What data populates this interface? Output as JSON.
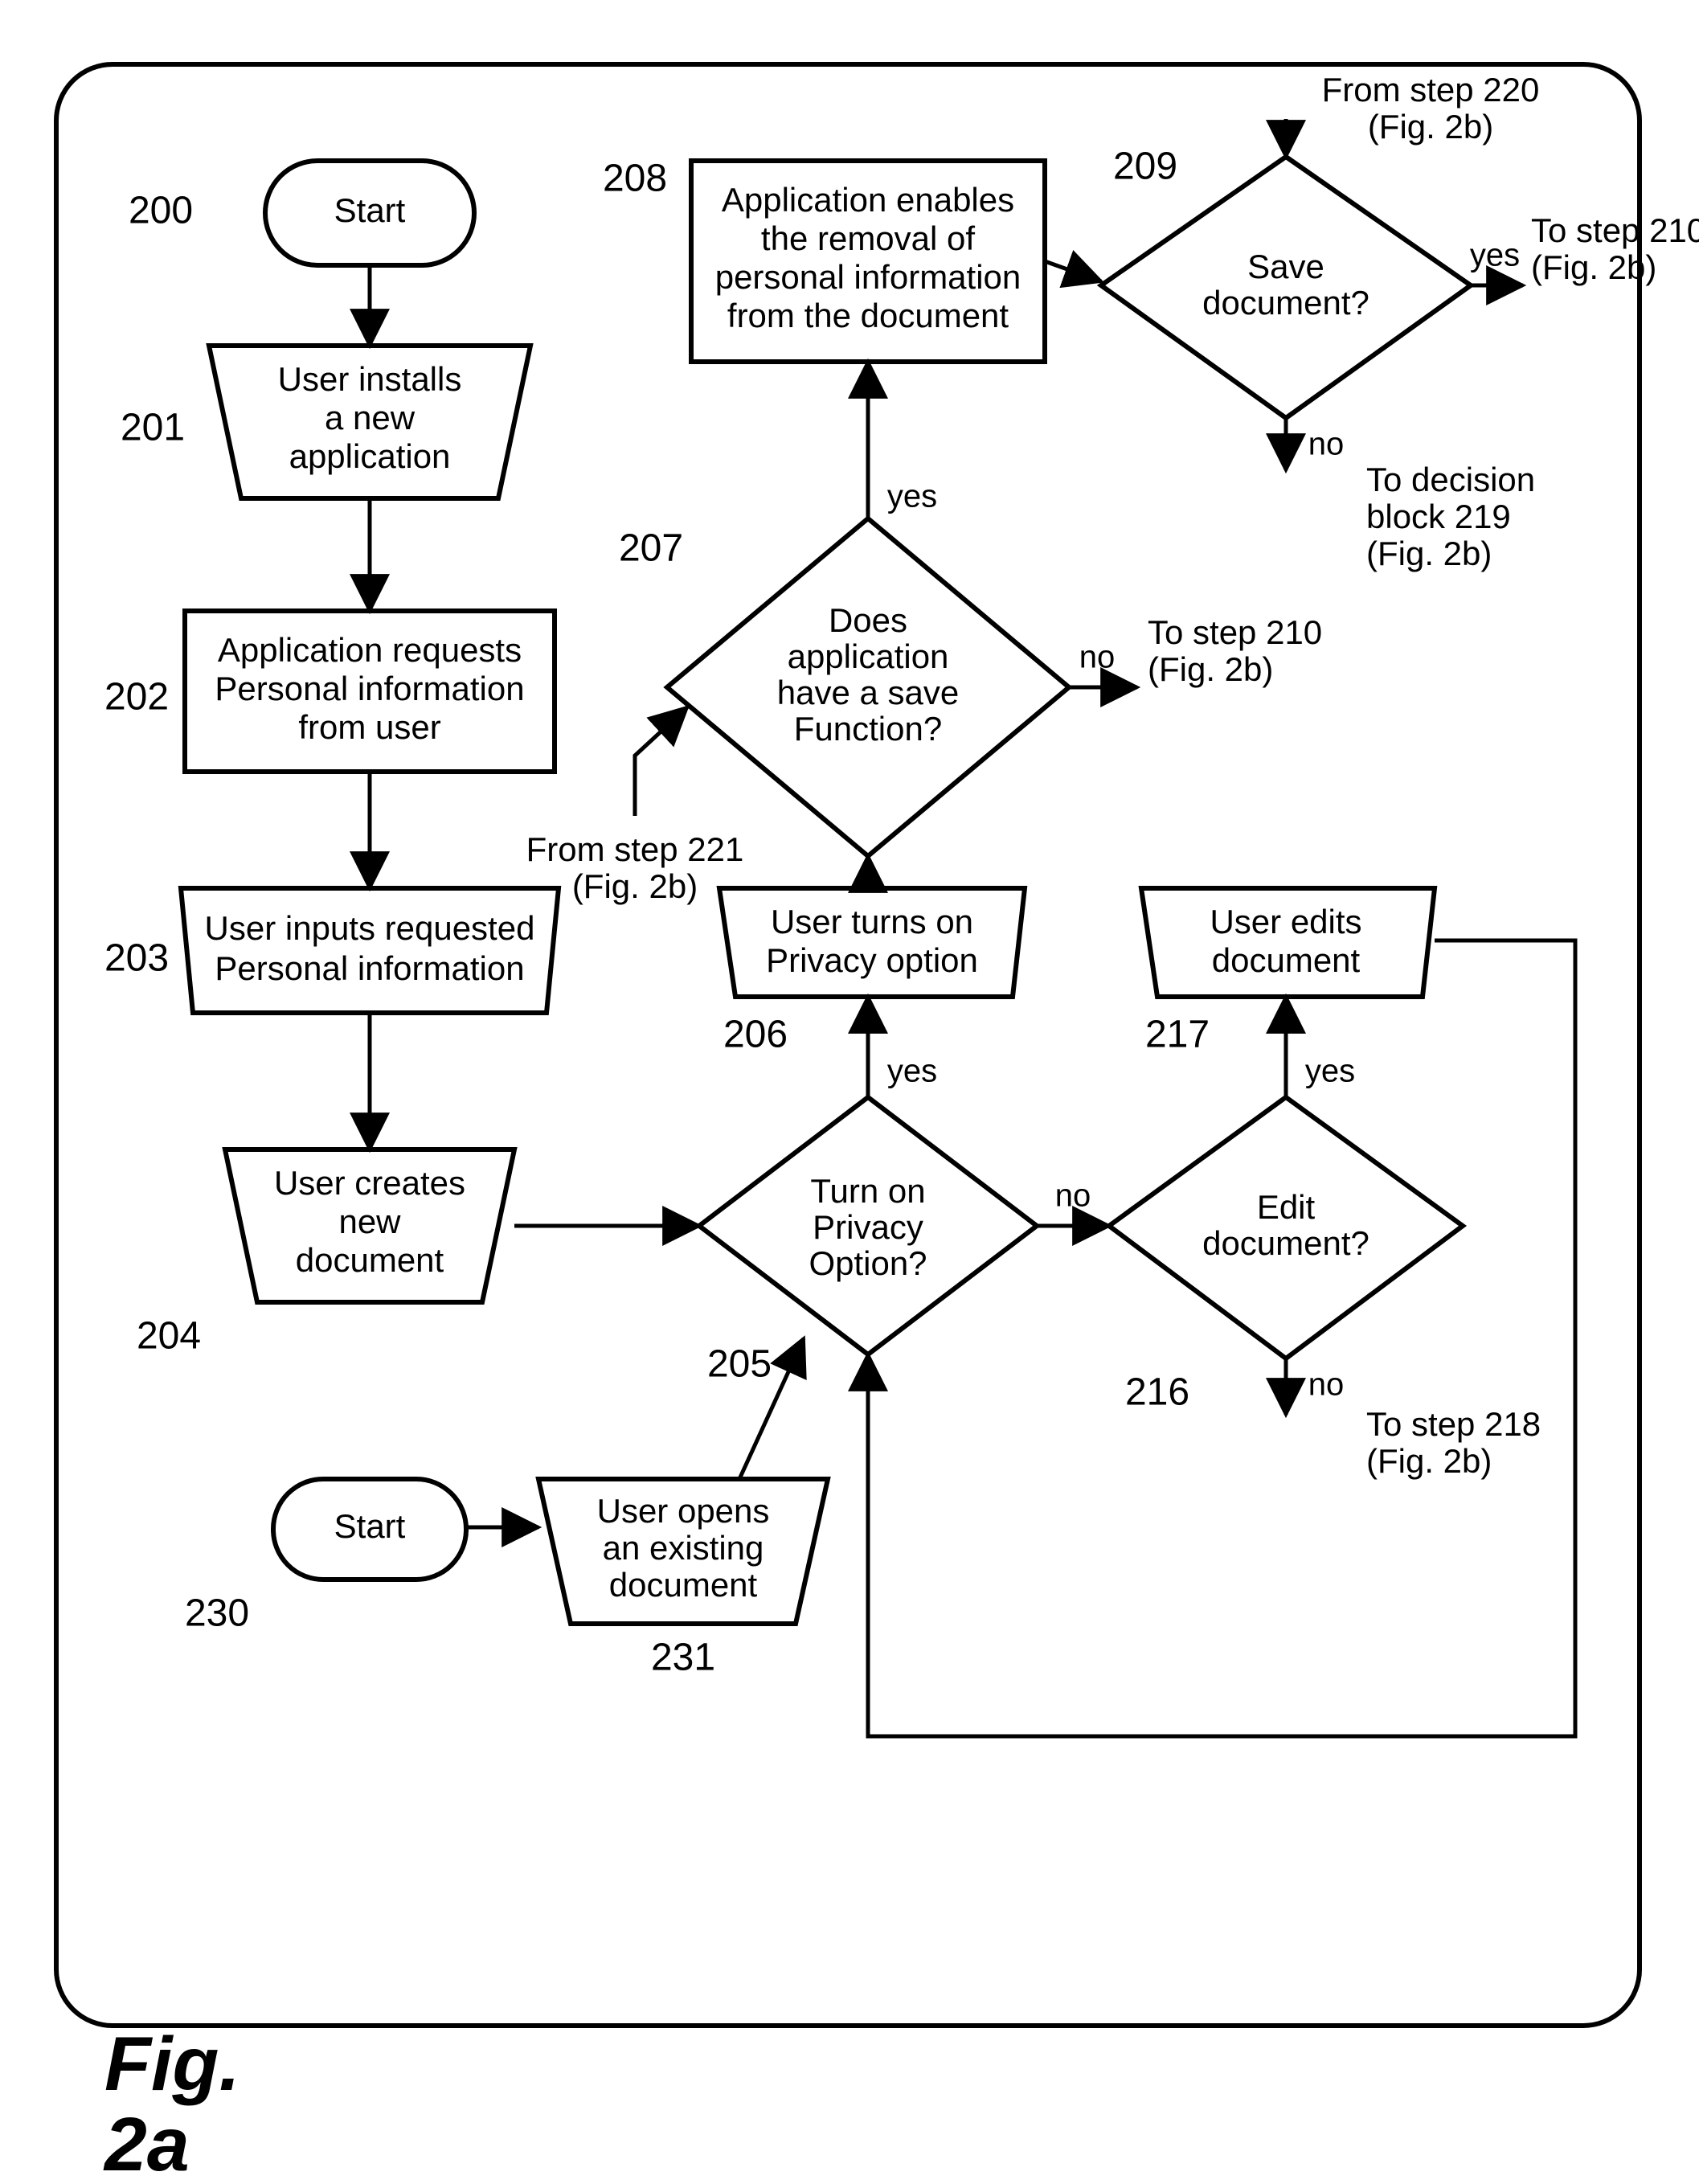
{
  "figure_label_top": "Fig.",
  "figure_label_bottom": "2a",
  "refs": {
    "r200": "200",
    "r201": "201",
    "r202": "202",
    "r203": "203",
    "r204": "204",
    "r205": "205",
    "r206": "206",
    "r207": "207",
    "r208": "208",
    "r209": "209",
    "r216": "216",
    "r217": "217",
    "r230": "230",
    "r231": "231"
  },
  "nodes": {
    "start1": "Start",
    "n201_l1": "User installs",
    "n201_l2": "a new",
    "n201_l3": "application",
    "n202_l1": "Application requests",
    "n202_l2": "Personal information",
    "n202_l3": "from user",
    "n203_l1": "User inputs requested",
    "n203_l2": "Personal information",
    "n204_l1": "User creates",
    "n204_l2": "new",
    "n204_l3": "document",
    "start2": "Start",
    "n231_l1": "User opens",
    "n231_l2": "an existing",
    "n231_l3": "document",
    "n205_l1": "Turn on",
    "n205_l2": "Privacy",
    "n205_l3": "Option?",
    "n206_l1": "User turns on",
    "n206_l2": "Privacy option",
    "n207_l1": "Does",
    "n207_l2": "application",
    "n207_l3": "have a save",
    "n207_l4": "Function?",
    "n208_l1": "Application enables",
    "n208_l2": "the removal of",
    "n208_l3": "personal information",
    "n208_l4": "from the document",
    "n209_l1": "Save",
    "n209_l2": "document?",
    "n216_l1": "Edit",
    "n216_l2": "document?",
    "n217_l1": "User edits",
    "n217_l2": "document"
  },
  "edges": {
    "yes": "yes",
    "no": "no"
  },
  "offpage": {
    "from221_l1": "From step 221",
    "from221_l2": "(Fig. 2b)",
    "from220_l1": "From step 220",
    "from220_l2": "(Fig. 2b)",
    "to210_l1": "To step 210",
    "to210_l2": "(Fig. 2b)",
    "to219_l1": "To decision",
    "to219_l2": "block 219",
    "to219_l3": "(Fig. 2b)",
    "to218_l1": "To step 218",
    "to218_l2": "(Fig. 2b)"
  }
}
